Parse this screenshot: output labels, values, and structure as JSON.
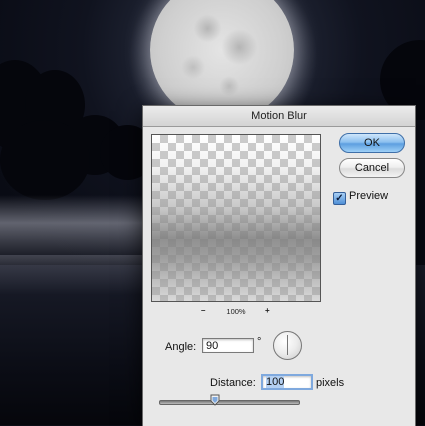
{
  "dialog": {
    "title": "Motion Blur",
    "ok_label": "OK",
    "cancel_label": "Cancel",
    "preview_label": "Preview",
    "preview_checked": true,
    "zoom": {
      "minus": "–",
      "level": "100%",
      "plus": "+"
    },
    "angle": {
      "label": "Angle:",
      "value": "90",
      "unit": "°"
    },
    "distance": {
      "label": "Distance:",
      "value": "100",
      "unit": "pixels",
      "slider_fraction": 0.4
    }
  },
  "colors": {
    "dialog_bg": "#e8e8e8",
    "ok_accent": "#5d9fe0",
    "focus_ring": "#7fa9de"
  },
  "icons": {
    "check": "checkmark-icon",
    "dial": "angle-dial-icon",
    "thumb": "slider-thumb-icon"
  }
}
